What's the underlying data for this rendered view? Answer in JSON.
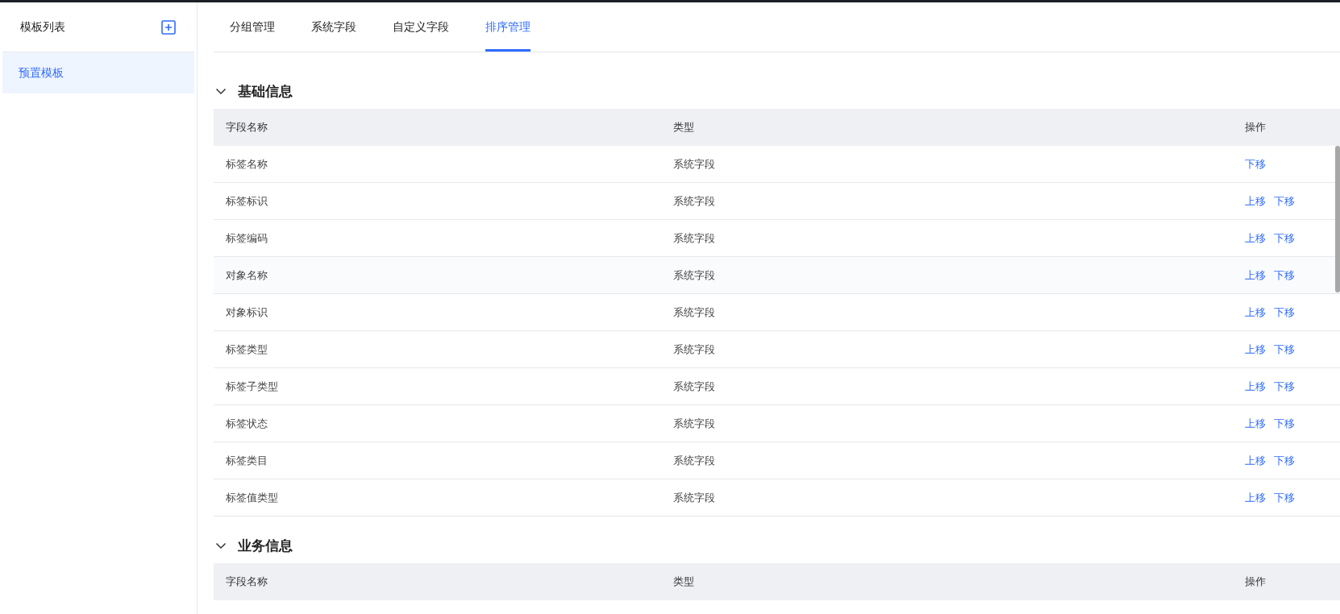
{
  "sidebar": {
    "title": "模板列表",
    "items": [
      {
        "label": "预置模板",
        "selected": true
      }
    ]
  },
  "tabs": [
    {
      "label": "分组管理",
      "selected": false
    },
    {
      "label": "系统字段",
      "selected": false
    },
    {
      "label": "自定义字段",
      "selected": false
    },
    {
      "label": "排序管理",
      "selected": true
    }
  ],
  "sections": [
    {
      "title": "基础信息",
      "expanded": true,
      "columns": [
        "字段名称",
        "类型",
        "操作"
      ],
      "rows": [
        {
          "name": "标签名称",
          "type": "系统字段",
          "hovered": false,
          "actions": [
            "下移"
          ]
        },
        {
          "name": "标签标识",
          "type": "系统字段",
          "hovered": false,
          "actions": [
            "上移",
            "下移"
          ]
        },
        {
          "name": "标签编码",
          "type": "系统字段",
          "hovered": false,
          "actions": [
            "上移",
            "下移"
          ]
        },
        {
          "name": "对象名称",
          "type": "系统字段",
          "hovered": true,
          "actions": [
            "上移",
            "下移"
          ]
        },
        {
          "name": "对象标识",
          "type": "系统字段",
          "hovered": false,
          "actions": [
            "上移",
            "下移"
          ]
        },
        {
          "name": "标签类型",
          "type": "系统字段",
          "hovered": false,
          "actions": [
            "上移",
            "下移"
          ]
        },
        {
          "name": "标签子类型",
          "type": "系统字段",
          "hovered": false,
          "actions": [
            "上移",
            "下移"
          ]
        },
        {
          "name": "标签状态",
          "type": "系统字段",
          "hovered": false,
          "actions": [
            "上移",
            "下移"
          ]
        },
        {
          "name": "标签类目",
          "type": "系统字段",
          "hovered": false,
          "actions": [
            "上移",
            "下移"
          ]
        },
        {
          "name": "标签值类型",
          "type": "系统字段",
          "hovered": false,
          "actions": [
            "上移",
            "下移"
          ]
        }
      ]
    },
    {
      "title": "业务信息",
      "expanded": true,
      "columns": [
        "字段名称",
        "类型",
        "操作"
      ]
    }
  ]
}
